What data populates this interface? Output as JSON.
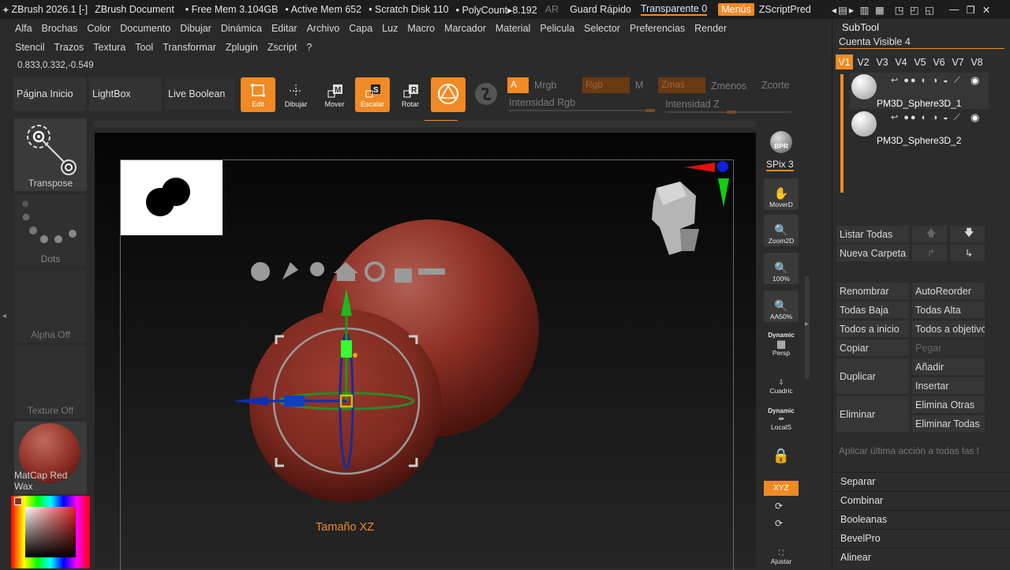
{
  "titlebar": {
    "app": "ZBrush 2026.1 [-]",
    "doc": "ZBrush Document",
    "free_mem": "• Free Mem 3.104GB",
    "active_mem": "• Active Mem 652",
    "scratch": "• Scratch Disk 110",
    "polycount": "• PolyCount▸8.192",
    "ar": "AR",
    "quicksave": "Guard Rápido",
    "transparent": "Transparente 0",
    "menus": "Menús",
    "zscriptpred": "ZScriptPred"
  },
  "menubar": {
    "row1": [
      "Alfa",
      "Brochas",
      "Color",
      "Documento",
      "Dibujar",
      "Dinámica",
      "Editar",
      "Archivo",
      "Capa",
      "Luz",
      "Macro",
      "Marcador",
      "Material",
      "Pelicula",
      "Selector",
      "Preferencias",
      "Render"
    ],
    "row2": [
      "Stencil",
      "Trazos",
      "Textura",
      "Tool",
      "Transformar",
      "Zplugin",
      "Zscript",
      "?"
    ]
  },
  "coords": "0.833,0.332,-0.549",
  "shelf": {
    "home": "Página Inicio",
    "lightbox": "LightBox",
    "live_boolean": "Live Boolean"
  },
  "tools": {
    "edit": "Edit",
    "draw": "Dibujar",
    "move": "Mover",
    "scale": "Escalar",
    "rotate": "Rotar"
  },
  "color_controls": {
    "a": "A",
    "mrgb": "Mrgb",
    "rgb": "Rgb",
    "m": "M",
    "zadd": "Zmas",
    "zsub": "Zmenos",
    "zcut": "Zcorte",
    "rgb_intensity": "Intensidad Rgb",
    "z_intensity": "Intensidad Z"
  },
  "left_tiles": {
    "transpose": "Transpose",
    "dots": "Dots",
    "alpha": "Alpha Off",
    "texture": "Texture Off",
    "material": "MatCap Red Wax"
  },
  "viewport": {
    "gizmo_label": "Tamaño XZ"
  },
  "right_toolbar": {
    "bpr": "BPR",
    "spix": "SPix 3",
    "move": "MoverD",
    "zoom": "Zoom2D",
    "zoom100": "100%",
    "aa50": "AA50%",
    "persp_top": "Dynamic",
    "persp": "Persp",
    "floor": "Cuadric",
    "local_top": "Dynamic",
    "local": "LocalS",
    "xyz": "XYZ",
    "fit": "Ajustar"
  },
  "subtool": {
    "title": "SubTool",
    "visible_count": "Cuenta Visible 4",
    "versions": [
      "V1",
      "V2",
      "V3",
      "V4",
      "V5",
      "V6",
      "V7",
      "V8"
    ],
    "items": [
      {
        "name": "PM3D_Sphere3D_1"
      },
      {
        "name": "PM3D_Sphere3D_2"
      }
    ],
    "list_all": "Listar Todas",
    "new_folder": "Nueva Carpeta",
    "rename": "Renombrar",
    "autoreorder": "AutoReorder",
    "all_low": "Todas Baja",
    "all_high": "Todas Alta",
    "all_to_start": "Todos a inicio",
    "all_to_target": "Todos a objetivo",
    "copy": "Copiar",
    "paste": "Pegar",
    "duplicate": "Duplicar",
    "append": "Añadir",
    "insert": "Insertar",
    "delete": "Eliminar",
    "delete_others": "Elimina Otras",
    "delete_all": "Eliminar Todas",
    "apply_last": "Aplicar última acción a todas las l",
    "sections": [
      "Separar",
      "Combinar",
      "Booleanas",
      "BevelPro",
      "Alinear"
    ]
  },
  "colors": {
    "accent": "#f08a24",
    "wax": "#8e2f25"
  }
}
